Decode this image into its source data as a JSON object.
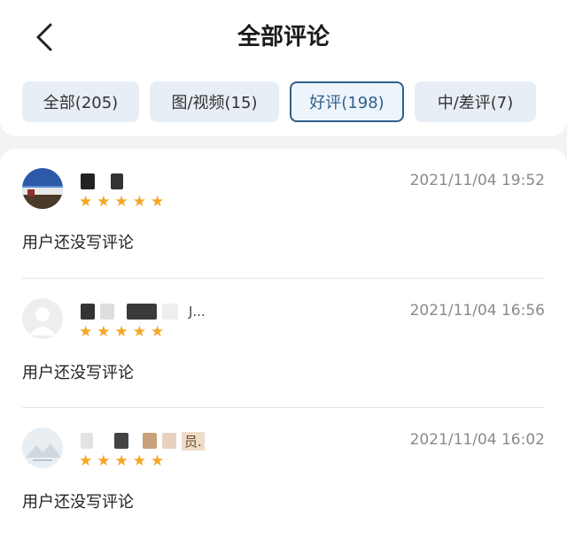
{
  "header": {
    "title": "全部评论",
    "back_icon": "chevron-left-icon"
  },
  "tabs": [
    {
      "label": "全部(205)",
      "active": false
    },
    {
      "label": "图/视频(15)",
      "active": false
    },
    {
      "label": "好评(198)",
      "active": true
    },
    {
      "label": "中/差评(7)",
      "active": false
    }
  ],
  "reviews": [
    {
      "name_suffix": "",
      "rating": 5,
      "date": "2021/11/04 19:52",
      "content": "用户还没写评论"
    },
    {
      "name_suffix": "J...",
      "rating": 5,
      "date": "2021/11/04 16:56",
      "content": "用户还没写评论"
    },
    {
      "name_suffix": "员.",
      "rating": 5,
      "date": "2021/11/04 16:02",
      "content": "用户还没写评论"
    }
  ],
  "colors": {
    "accent": "#2f5f8a",
    "star": "#f5a623",
    "tab_bg": "#e8eef5"
  }
}
